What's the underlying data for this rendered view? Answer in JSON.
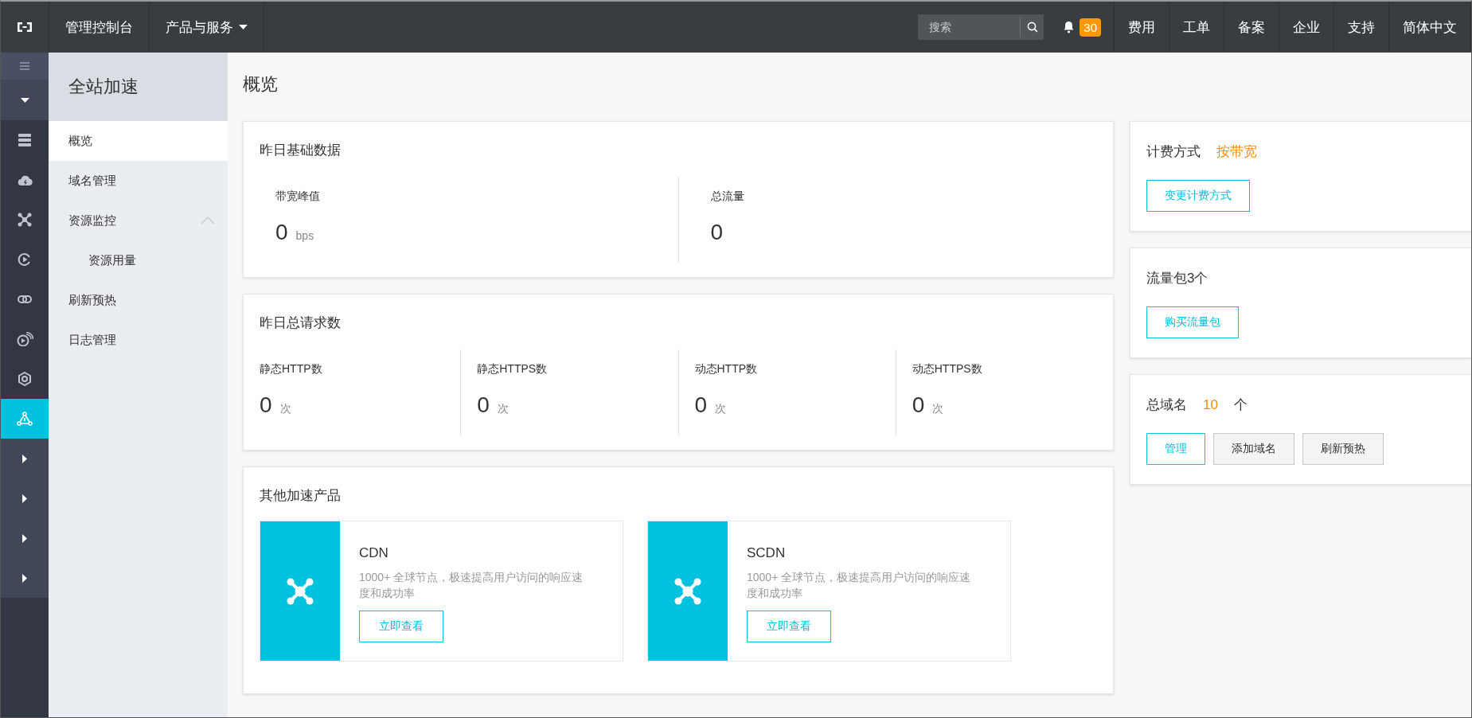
{
  "topbar": {
    "console_label": "管理控制台",
    "products_menu": "产品与服务",
    "search": {
      "placeholder": "搜索"
    },
    "notification_count": "30",
    "nav_items": [
      "费用",
      "工单",
      "备案",
      "企业",
      "支持",
      "简体中文"
    ]
  },
  "icon_sidebar": {
    "items": [
      {
        "kind": "menu",
        "selected": false
      },
      {
        "kind": "caret-down",
        "selected": false
      },
      {
        "kind": "storage",
        "selected": false
      },
      {
        "kind": "cloud",
        "selected": false
      },
      {
        "kind": "nodes",
        "selected": false
      },
      {
        "kind": "play",
        "selected": false
      },
      {
        "kind": "link",
        "selected": false
      },
      {
        "kind": "broadcast",
        "selected": false
      },
      {
        "kind": "hexagon",
        "selected": false
      },
      {
        "kind": "share",
        "selected": true
      },
      {
        "kind": "caret-right",
        "selected": false
      },
      {
        "kind": "caret-right",
        "selected": false
      },
      {
        "kind": "caret-right",
        "selected": false
      },
      {
        "kind": "caret-right",
        "selected": false
      }
    ]
  },
  "nav_menu": {
    "title": "全站加速",
    "items": [
      {
        "label": "概览",
        "selected": true
      },
      {
        "label": "域名管理",
        "selected": false
      },
      {
        "label": "资源监控",
        "selected": false,
        "expanded": true,
        "children": [
          {
            "label": "资源用量",
            "selected": false
          }
        ]
      },
      {
        "label": "刷新预热",
        "selected": false
      },
      {
        "label": "日志管理",
        "selected": false
      }
    ]
  },
  "main": {
    "title": "概览",
    "basic_data": {
      "title": "昨日基础数据",
      "metrics": [
        {
          "label": "带宽峰值",
          "value": "0",
          "unit": "bps"
        },
        {
          "label": "总流量",
          "value": "0"
        }
      ]
    },
    "requests": {
      "title": "昨日总请求数",
      "metrics": [
        {
          "label": "静态HTTP数",
          "value": "0",
          "unit": "次"
        },
        {
          "label": "静态HTTPS数",
          "value": "0",
          "unit": "次"
        },
        {
          "label": "动态HTTP数",
          "value": "0",
          "unit": "次"
        },
        {
          "label": "动态HTTPS数",
          "value": "0",
          "unit": "次"
        }
      ]
    },
    "other_products": {
      "title": "其他加速产品",
      "products": [
        {
          "name": "CDN",
          "description": "1000+ 全球节点，极速提高用户访问的响应速度和成功率",
          "button": "立即查看"
        },
        {
          "name": "SCDN",
          "description": "1000+ 全球节点，极速提高用户访问的响应速度和成功率",
          "button": "立即查看"
        }
      ]
    },
    "billing": {
      "label": "计费方式",
      "value": "按带宽",
      "button": "变更计费方式"
    },
    "packages": {
      "title": "流量包3个",
      "button": "购买流量包"
    },
    "domains": {
      "label": "总域名",
      "count": "10",
      "unit": "个",
      "buttons": [
        {
          "label": "管理",
          "kind": "primary"
        },
        {
          "label": "添加域名",
          "kind": "default"
        },
        {
          "label": "刷新预热",
          "kind": "default"
        }
      ]
    }
  }
}
